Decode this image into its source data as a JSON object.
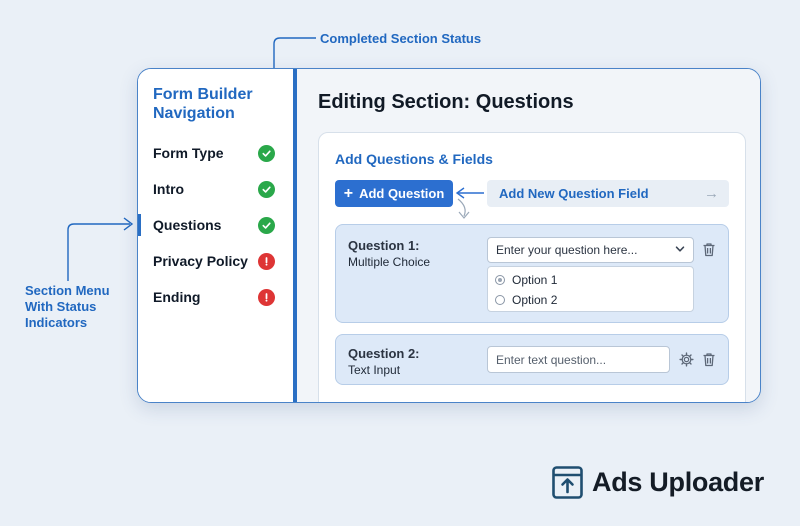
{
  "annotations": {
    "top_label": "Completed Section Status",
    "left_label": "Section Menu With Status Indicators"
  },
  "sidebar": {
    "title": "Form Builder Navigation",
    "items": [
      {
        "label": "Form Type",
        "status": "complete"
      },
      {
        "label": "Intro",
        "status": "complete"
      },
      {
        "label": "Questions",
        "status": "complete",
        "active": true
      },
      {
        "label": "Privacy Policy",
        "status": "incomplete"
      },
      {
        "label": "Ending",
        "status": "incomplete"
      }
    ]
  },
  "main": {
    "title": "Editing Section: Questions",
    "card": {
      "title": "Add Questions & Fields",
      "add_button": "Add Question",
      "hint": "Add New Question Field",
      "questions": [
        {
          "label": "Question 1:",
          "type": "Multiple Choice",
          "select_value": "Enter your question here...",
          "options": [
            "Option 1",
            "Option 2"
          ],
          "selected_option": 0
        },
        {
          "label": "Question 2:",
          "type": "Text Input",
          "placeholder": "Enter text question..."
        }
      ]
    }
  },
  "brand": {
    "name": "Ads Uploader"
  },
  "colors": {
    "accent": "#2c6fd0",
    "complete": "#2aa84a",
    "incomplete": "#de3535",
    "background": "#eaf0f7"
  }
}
